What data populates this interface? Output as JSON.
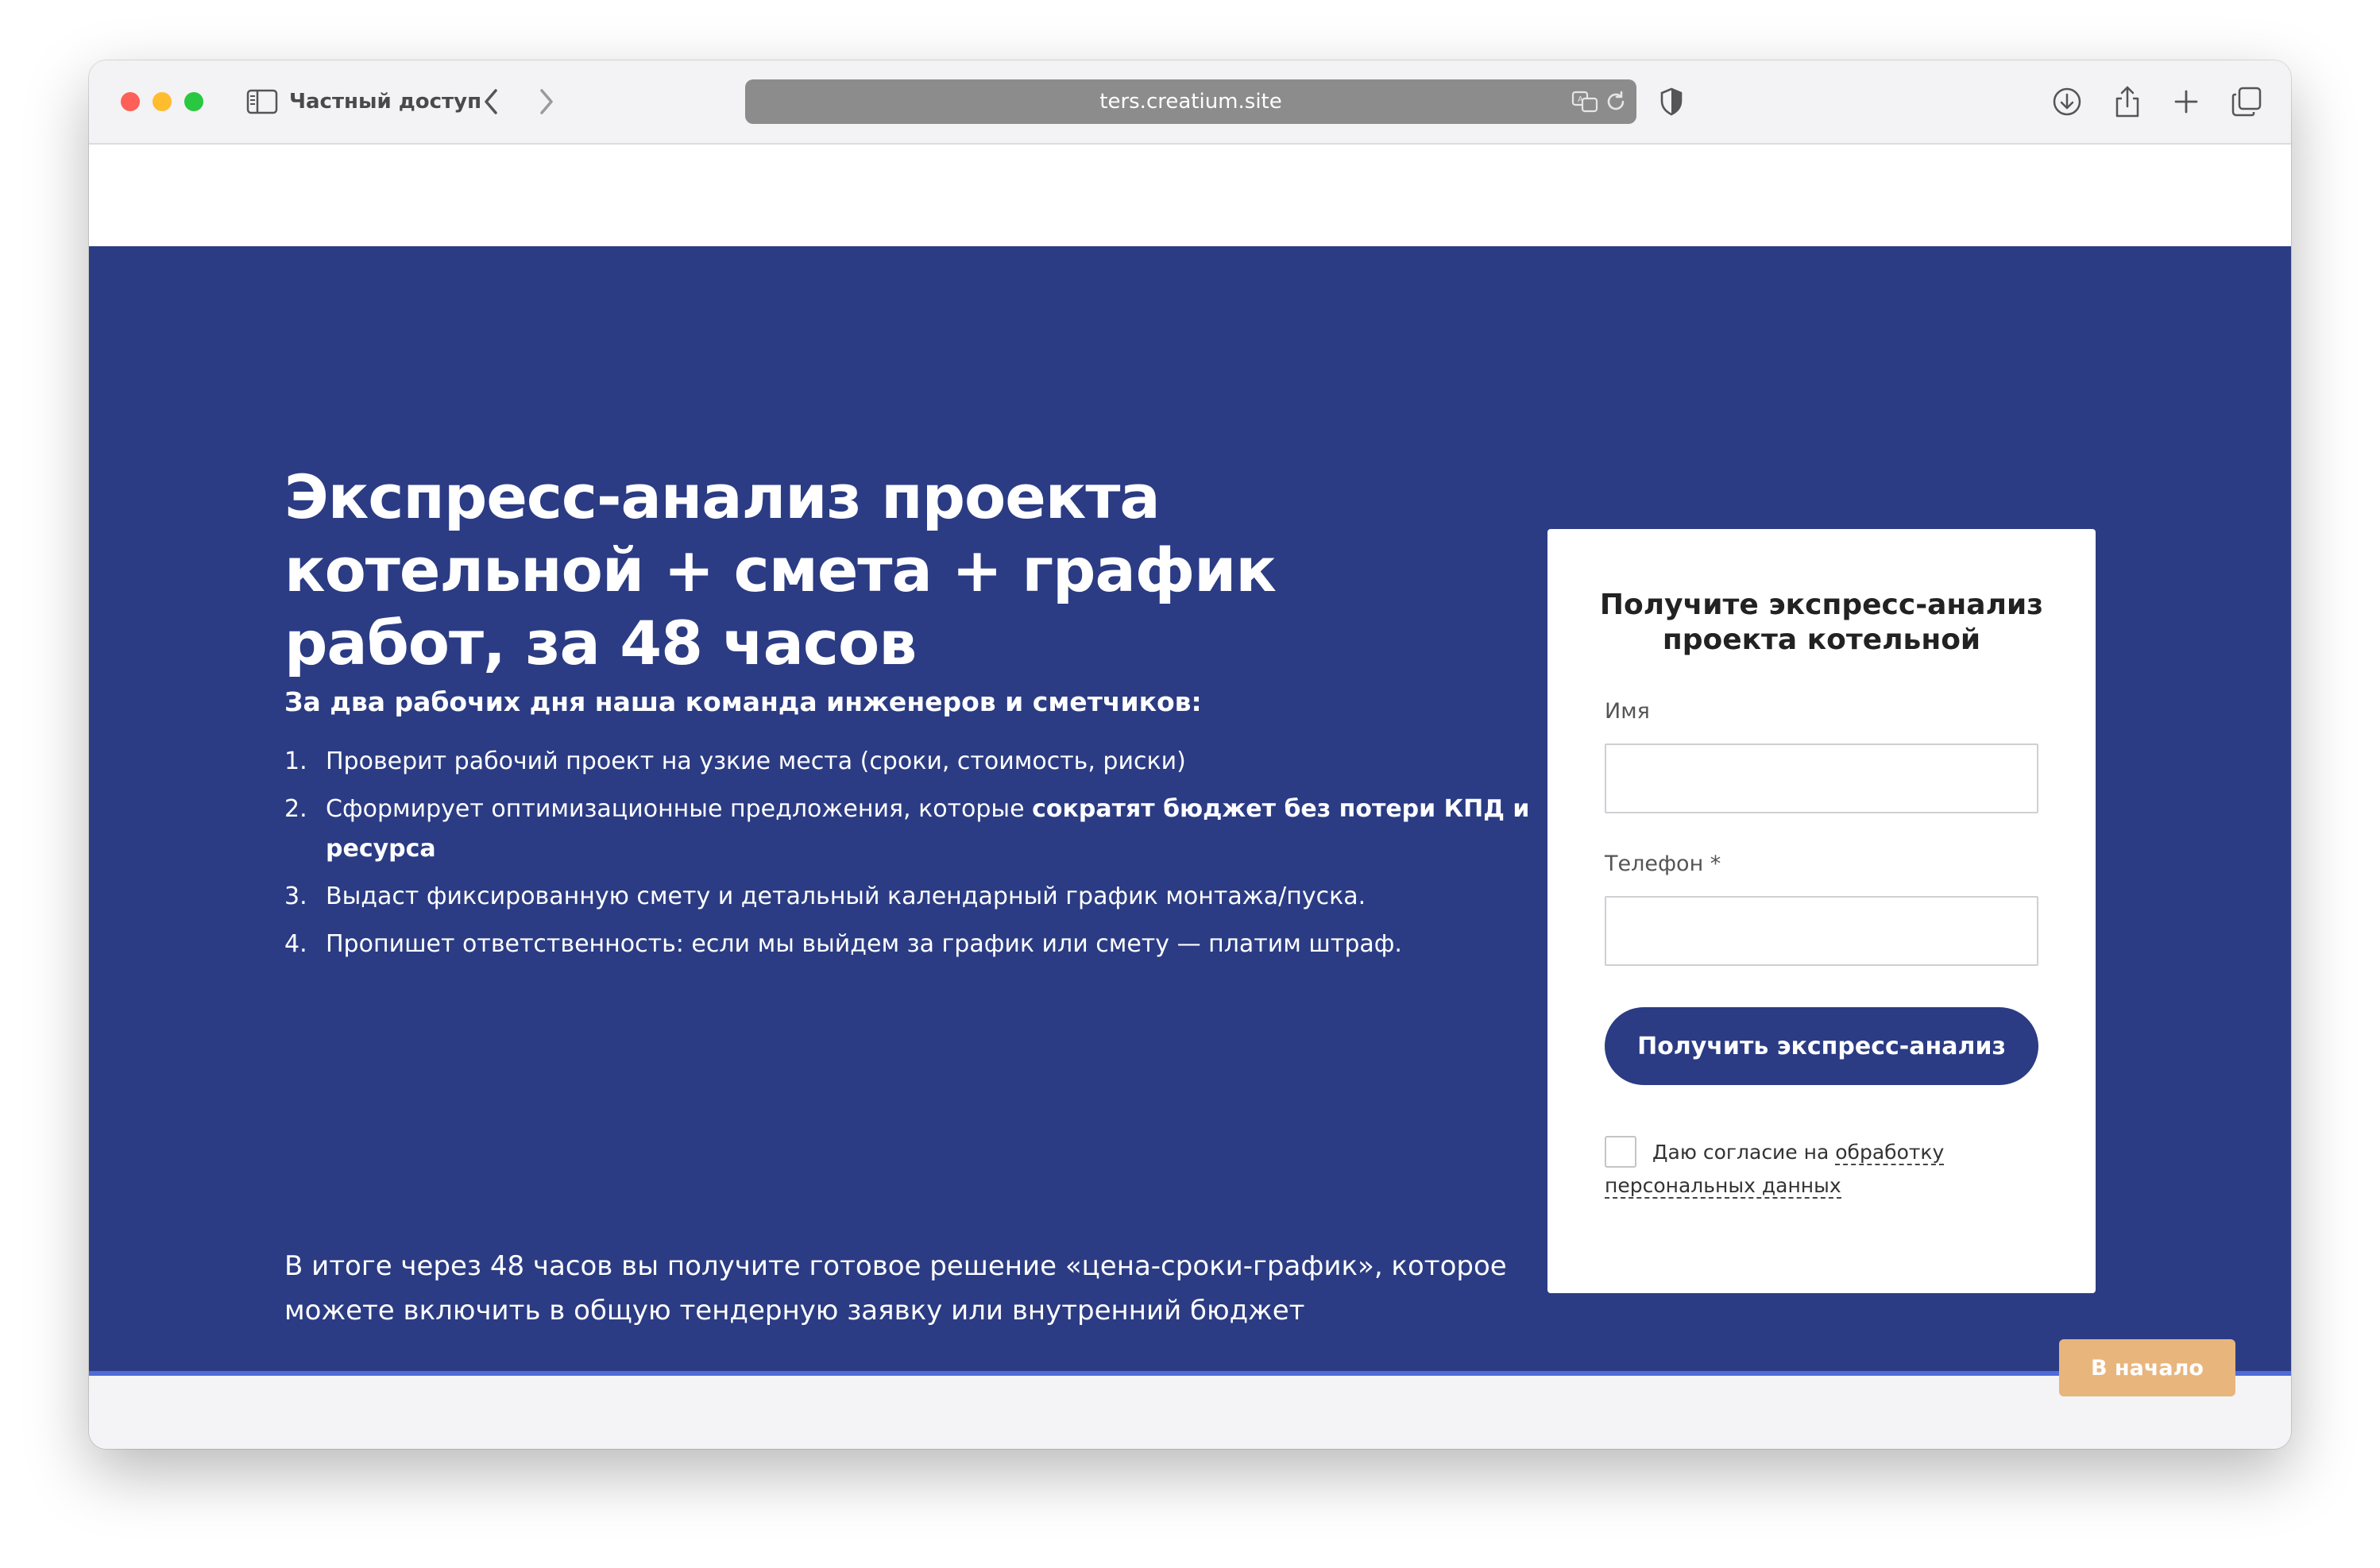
{
  "browser": {
    "private_label": "Частный доступ",
    "url": "ters.creatium.site"
  },
  "hero": {
    "title": "Экспресс-анализ проекта котельной + смета + график работ, за 48 часов",
    "subtitle": "За два рабочих дня наша команда инженеров и сметчиков:",
    "steps": [
      {
        "num": "1.",
        "text": "Проверит рабочий проект на узкие места (сроки, стоимость, риски)",
        "bold": ""
      },
      {
        "num": "2.",
        "text": "Сформирует оптимизационные предложения, которые ",
        "bold": "сократят бюджет без потери КПД и ресурса"
      },
      {
        "num": "3.",
        "text": "Выдаст фиксированную смету и детальный календарный график монтажа/пуска.",
        "bold": ""
      },
      {
        "num": "4.",
        "text": "Пропишет ответственность: если мы выйдем за график или смету — платим штраф.",
        "bold": ""
      }
    ],
    "summary": "В итоге через 48 часов вы получите готовое решение «цена-сроки-график», которое можете включить в общую тендерную заявку или внутренний бюджет"
  },
  "form": {
    "title": "Получите экспресс-анализ проекта котельной",
    "name_label": "Имя",
    "name_value": "",
    "phone_label": "Телефон *",
    "phone_value": "",
    "submit_label": "Получить экспресс-анализ",
    "consent_text": "Даю согласие на ",
    "consent_link": "обработку персональных данных"
  },
  "back_to_top": "В начало",
  "colors": {
    "hero_bg": "#2b3c84",
    "button_bg": "#2b3c84",
    "back_top_bg": "#e8b57d",
    "accent_line": "#4f6bd8"
  },
  "icons": [
    "sidebar-icon",
    "chevron-left-icon",
    "chevron-right-icon",
    "translate-icon",
    "reload-icon",
    "shield-icon",
    "download-icon",
    "share-icon",
    "plus-icon",
    "tabs-icon"
  ]
}
